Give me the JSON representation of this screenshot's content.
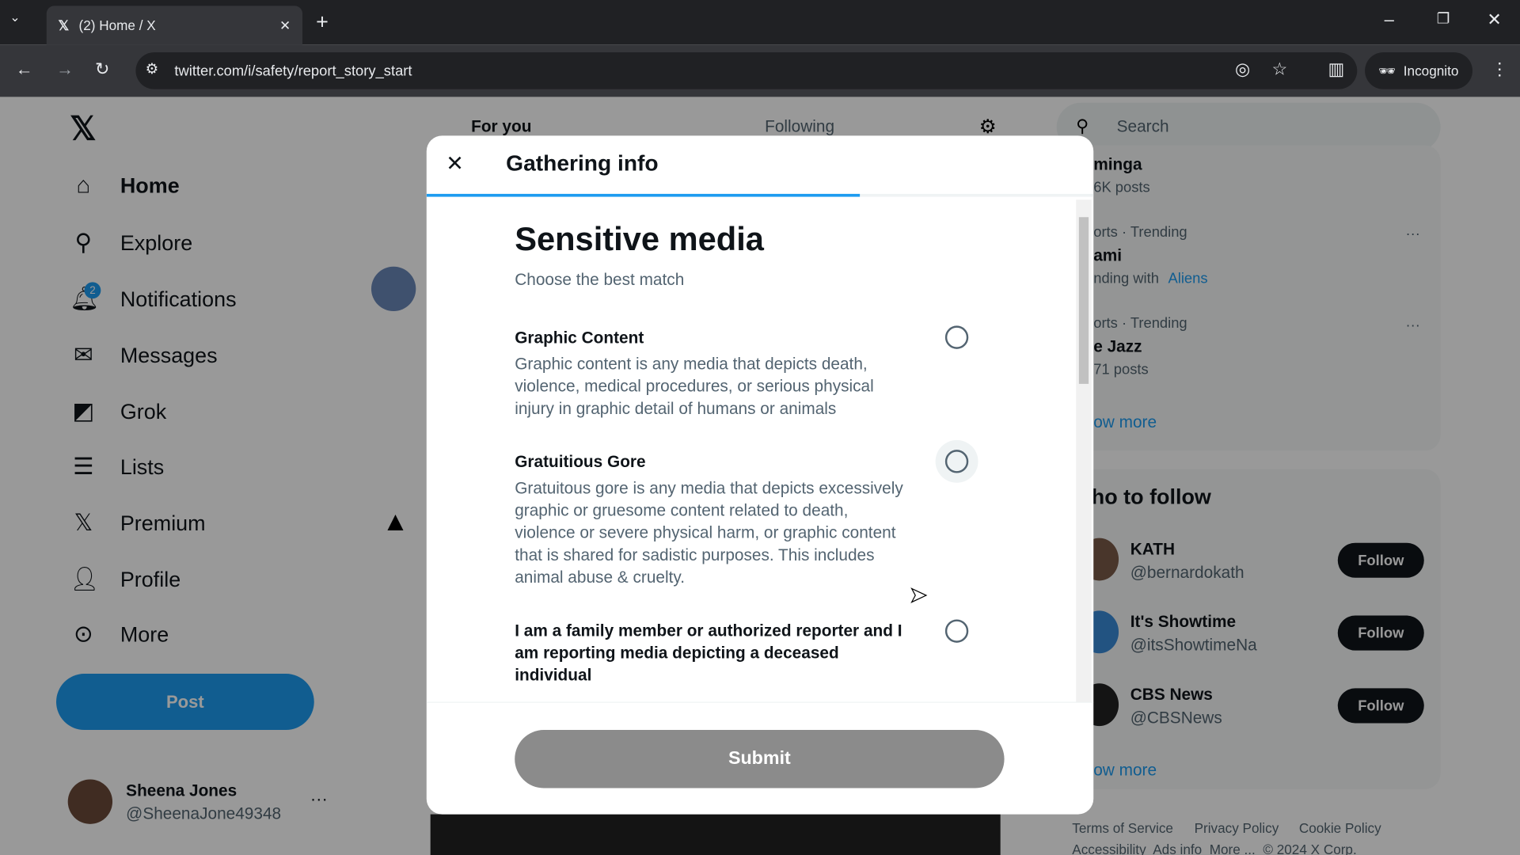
{
  "browser": {
    "tab_title": "(2) Home / X",
    "url": "twitter.com/i/safety/report_story_start",
    "incognito": "Incognito"
  },
  "sidebar": {
    "items": [
      {
        "label": "Home",
        "icon": "home-icon",
        "glyph": "⌂"
      },
      {
        "label": "Explore",
        "icon": "search-icon",
        "glyph": "⚲"
      },
      {
        "label": "Notifications",
        "icon": "bell-icon",
        "glyph": "🔔︎"
      },
      {
        "label": "Messages",
        "icon": "mail-icon",
        "glyph": "✉"
      },
      {
        "label": "Grok",
        "icon": "grok-icon",
        "glyph": "◩"
      },
      {
        "label": "Lists",
        "icon": "list-icon",
        "glyph": "☰"
      },
      {
        "label": "Premium",
        "icon": "x-icon",
        "glyph": "𝕏"
      },
      {
        "label": "Profile",
        "icon": "person-icon",
        "glyph": "👤︎"
      },
      {
        "label": "More",
        "icon": "more-circle-icon",
        "glyph": "⊙"
      }
    ],
    "notification_badge": "2",
    "post_label": "Post",
    "user_name": "Sheena Jones",
    "user_handle": "@SheenaJone49348"
  },
  "timeline": {
    "tabs": [
      "For you",
      "Following"
    ]
  },
  "right": {
    "search_placeholder": "Search",
    "trends": [
      {
        "name": "minga",
        "meta": "6K posts"
      },
      {
        "cat": "orts · Trending",
        "name": "ami",
        "meta": "nding with",
        "link": "Aliens"
      },
      {
        "cat": "orts · Trending",
        "name": "e Jazz",
        "meta": "71 posts"
      }
    ],
    "show_more": "ow more",
    "who_to_follow": "ho to follow",
    "follow": [
      {
        "name": "KATH",
        "handle": "@bernardokath"
      },
      {
        "name": "It's Showtime",
        "handle": "@itsShowtimeNa"
      },
      {
        "name": "CBS News",
        "handle": "@CBSNews"
      }
    ],
    "follow_label": "Follow",
    "show_more2": "ow more",
    "footer": [
      "Terms of Service",
      "Privacy Policy",
      "Cookie Policy"
    ],
    "footer2": "Accessibility  Ads info  More ...  © 2024 X Corp."
  },
  "modal": {
    "title": "Gathering info",
    "progress_percent": 65,
    "heading": "Sensitive media",
    "subheading": "Choose the best match",
    "options": [
      {
        "title": "Graphic Content",
        "desc": "Graphic content is any media that depicts death, violence, medical procedures, or serious physical injury in graphic detail of humans or animals"
      },
      {
        "title": "Gratuitious Gore",
        "desc": "Gratuitous gore is any media that depicts excessively graphic or gruesome content related to death, violence or severe physical harm, or graphic content that is shared for sadistic purposes. This includes animal abuse & cruelty."
      },
      {
        "title": "I am a family member or authorized reporter and I am reporting media depicting a deceased individual",
        "desc": ""
      }
    ],
    "submit": "Submit"
  },
  "colors": {
    "accent": "#1d9bf0",
    "submit_disabled": "#8b8b8b"
  }
}
